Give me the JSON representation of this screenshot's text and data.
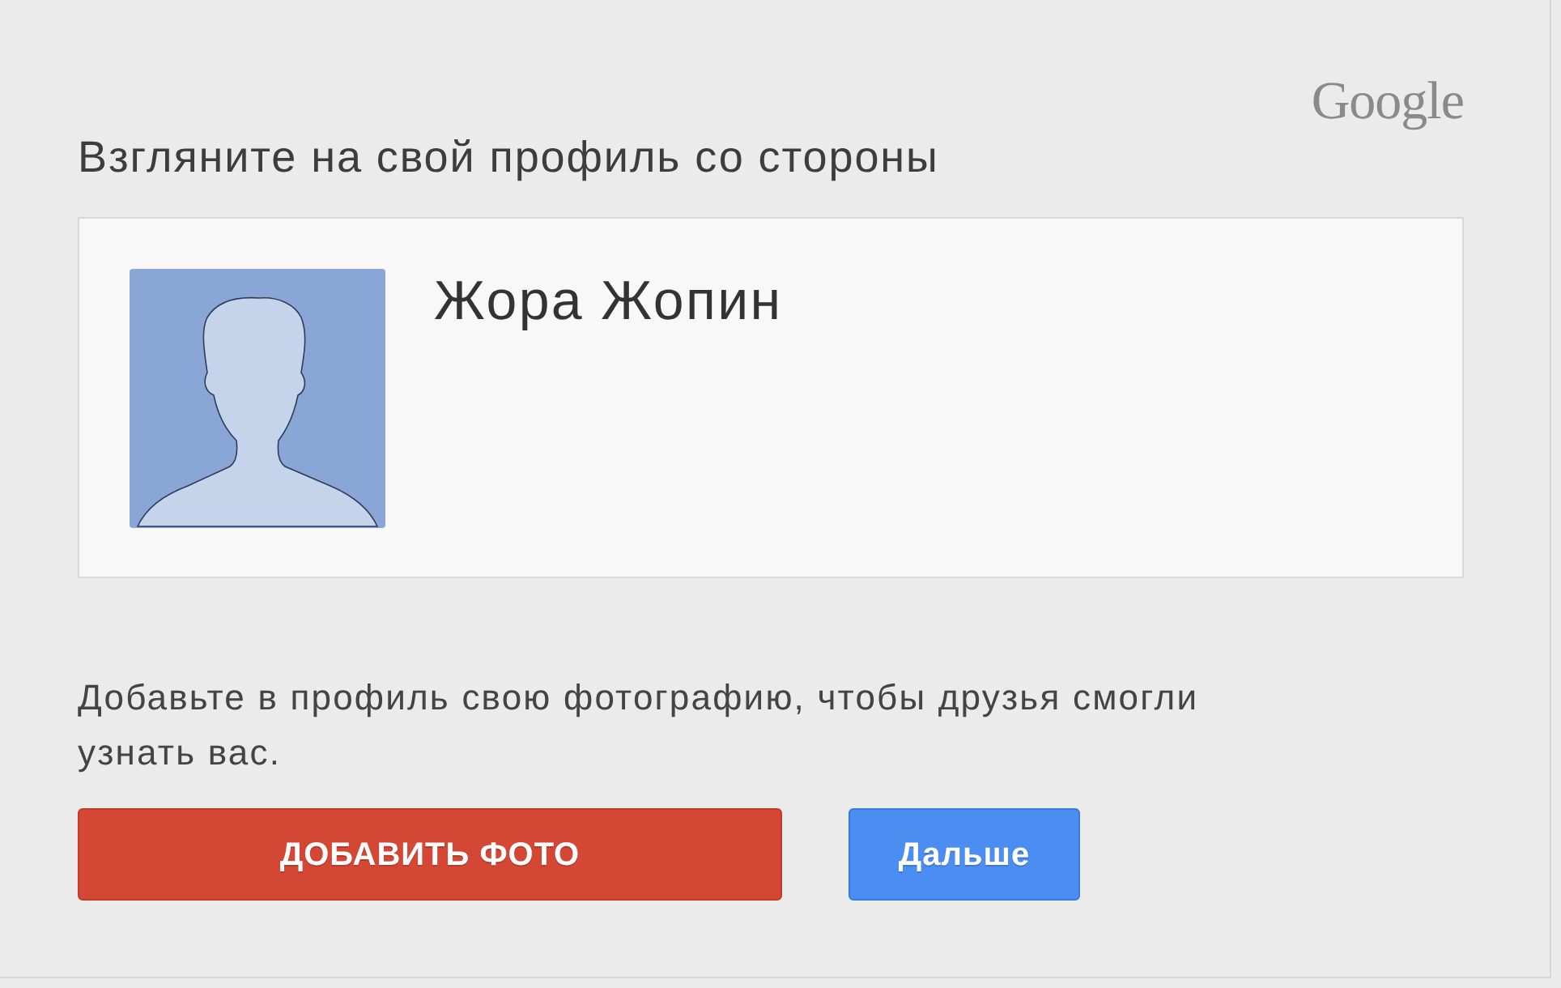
{
  "logo": "Google",
  "heading": "Взгляните на свой профиль со стороны",
  "profile": {
    "name": "Жора Жопин"
  },
  "prompt": "Добавьте в профиль свою фотографию, чтобы друзья смогли узнать вас.",
  "buttons": [
    {
      "label": "ДОБАВИТЬ ФОТО",
      "kind": "primary"
    },
    {
      "label": "Дальше",
      "kind": "secondary"
    }
  ]
}
